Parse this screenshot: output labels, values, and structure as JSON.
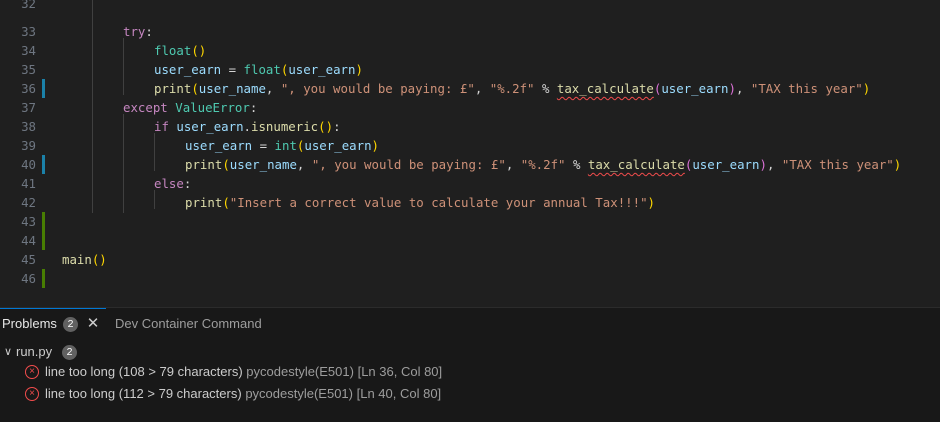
{
  "editor": {
    "lines": [
      {
        "n": "32",
        "mark": ""
      },
      {
        "n": "33",
        "mark": ""
      },
      {
        "n": "34",
        "mark": ""
      },
      {
        "n": "35",
        "mark": ""
      },
      {
        "n": "36",
        "mark": "blue"
      },
      {
        "n": "37",
        "mark": ""
      },
      {
        "n": "38",
        "mark": ""
      },
      {
        "n": "39",
        "mark": ""
      },
      {
        "n": "40",
        "mark": "blue"
      },
      {
        "n": "41",
        "mark": ""
      },
      {
        "n": "42",
        "mark": ""
      },
      {
        "n": "43",
        "mark": "green"
      },
      {
        "n": "44",
        "mark": "green"
      },
      {
        "n": "45",
        "mark": ""
      },
      {
        "n": "46",
        "mark": "green"
      }
    ],
    "code": {
      "l33_try": "try",
      "l33_colon": ":",
      "l34_fn": "float",
      "l34_paren": "()",
      "l35_var": "user_earn",
      "l35_eq": " = ",
      "l35_fn": "float",
      "l35_arg": "user_earn",
      "l36_print": "print",
      "l36_a": "user_name",
      "l36_comma": ", ",
      "l36_s1": "\", you would be paying: £\"",
      "l36_comma2": ", ",
      "l36_s2": "\"%.2f\"",
      "l36_pct": " % ",
      "l36_fn": "tax_calculate",
      "l36_arg": "user_earn",
      "l36_comma3": ", ",
      "l36_s3": "\"TAX this year\"",
      "l37_except": "except",
      "l37_err": "ValueError",
      "l37_colon": ":",
      "l38_if": "if",
      "l38_var": "user_earn",
      "l38_dot": ".",
      "l38_fn": "isnumeric",
      "l38_paren": "()",
      "l38_colon": ":",
      "l39_var": "user_earn",
      "l39_eq": " = ",
      "l39_fn": "int",
      "l39_arg": "user_earn",
      "l40_print": "print",
      "l40_a": "user_name",
      "l40_comma": ", ",
      "l40_s1": "\", you would be paying: £\"",
      "l40_comma2": ", ",
      "l40_s2": "\"%.2f\"",
      "l40_pct": " % ",
      "l40_fn": "tax_calculate",
      "l40_arg": "user_earn",
      "l40_comma3": ", ",
      "l40_s3": "\"TAX this year\"",
      "l41_else": "else",
      "l41_colon": ":",
      "l42_print": "print",
      "l42_s": "\"Insert a correct value to calculate your annual Tax!!!\"",
      "l45_fn": "main",
      "l45_paren": "()"
    }
  },
  "panel": {
    "tabs": [
      {
        "label": "Problems",
        "badge": "2"
      },
      {
        "label": "Dev Container Command"
      }
    ],
    "close_glyph": "✕",
    "file": {
      "name": "run.py",
      "count": "2",
      "chevron": "∨"
    },
    "problems": [
      {
        "message": "line too long (108 > 79 characters)",
        "source": "pycodestyle(E501)",
        "location": "[Ln 36, Col 80]"
      },
      {
        "message": "line too long (112 > 79 characters)",
        "source": "pycodestyle(E501)",
        "location": "[Ln 40, Col 80]"
      }
    ],
    "error_glyph": "×"
  },
  "colors": {
    "error": "#f14c4c",
    "accent": "#0078d4",
    "modified_gutter": "#1b81a8",
    "added_gutter": "#487e02"
  }
}
